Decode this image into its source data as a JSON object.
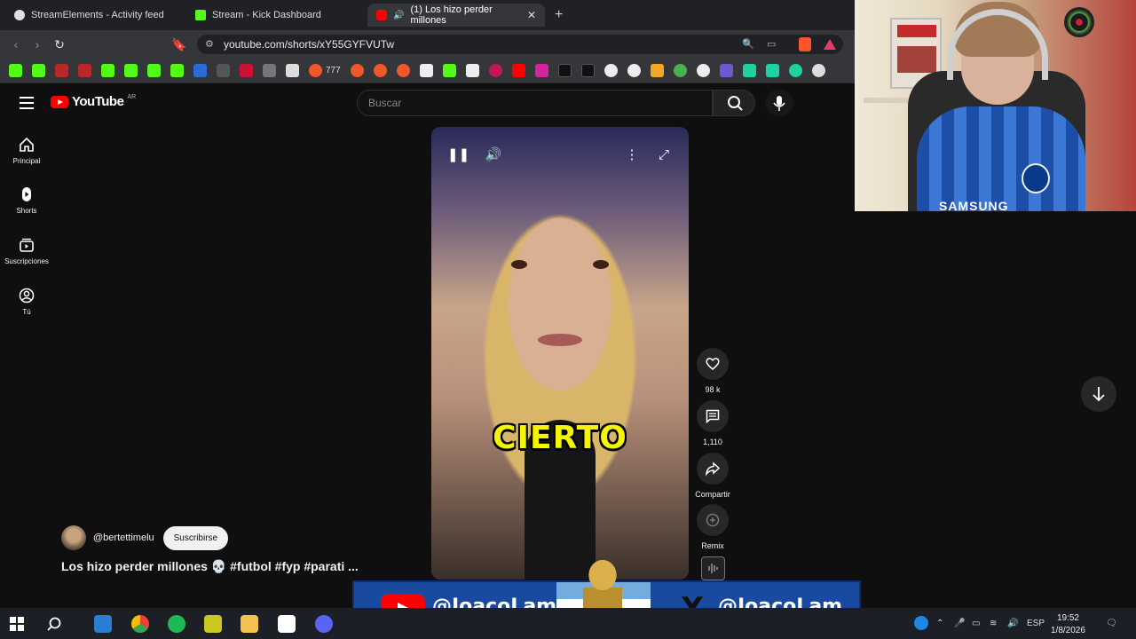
{
  "browser": {
    "tabs": [
      {
        "title": "StreamElements - Activity feed",
        "favicon_color": "#e0e0e0"
      },
      {
        "title": "Stream - Kick Dashboard",
        "favicon_color": "#53fc18"
      },
      {
        "title": "(1) Los hizo perder millones",
        "favicon_color": "#ff0000",
        "close": "✕"
      }
    ],
    "new_tab": "+",
    "url": "youtube.com/shorts/xY55GYFVUTw",
    "bookmark_extra_label": "777"
  },
  "youtube": {
    "logo_text": "YouTube",
    "region": "AR",
    "search_placeholder": "Buscar",
    "sidebar": [
      {
        "label": "Principal",
        "icon": "home-icon"
      },
      {
        "label": "Shorts",
        "icon": "shorts-icon"
      },
      {
        "label": "Suscripciones",
        "icon": "subscriptions-icon"
      },
      {
        "label": "Tú",
        "icon": "you-icon"
      }
    ],
    "caption": "CIERTO",
    "actions": {
      "like_count": "98 k",
      "comment_count": "1,110",
      "share_label": "Compartir",
      "remix_label": "Remix"
    },
    "channel": "@bertettimelu",
    "subscribe_label": "Suscribirse",
    "video_title": "Los hizo perder millones 💀 #futbol #fyp #parati ..."
  },
  "webcam": {
    "sponsor_text": "SAMSUNG"
  },
  "overlay": {
    "youtube_handle": "@JoacoLam_",
    "x_handle": "@JoacoLam",
    "x_logo": "X"
  },
  "taskbar": {
    "language": "ESP",
    "time": "19:52",
    "date": "1/8/2026"
  }
}
